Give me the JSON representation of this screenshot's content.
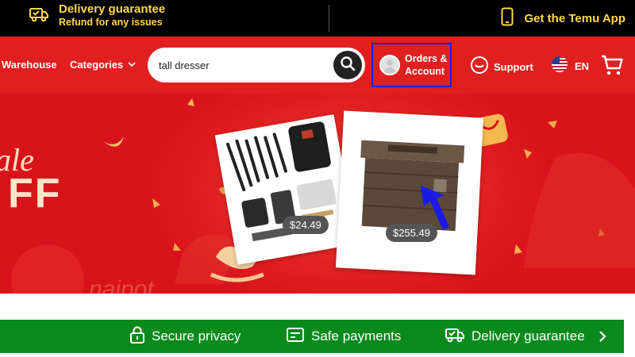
{
  "topbar": {
    "delivery_title": "Delivery guarantee",
    "delivery_sub": "Refund for any issues",
    "app_label": "Get the Temu App",
    "accent": "#ffd84a"
  },
  "header": {
    "nav": {
      "warehouse": "Warehouse",
      "categories": "Categories"
    },
    "search": {
      "value": "tall dresser",
      "icon": "search-icon"
    },
    "account": {
      "line1": "Orders &",
      "line2": "Account"
    },
    "support_label": "Support",
    "language": "EN",
    "colors": {
      "header_bg": "#e01f1f",
      "highlight_box": "#1a1ae6"
    }
  },
  "banner": {
    "sale_text": "ale",
    "off_text": "FF",
    "watermark": "naipot",
    "products": [
      {
        "name": "survival-kit",
        "price": "$24.49"
      },
      {
        "name": "fire-pit-table",
        "price": "$255.49"
      }
    ],
    "colors": {
      "banner_bg": "#d9131b"
    }
  },
  "trust_bar": {
    "items": [
      {
        "label": "Secure privacy",
        "icon": "lock-icon"
      },
      {
        "label": "Safe payments",
        "icon": "card-icon"
      },
      {
        "label": "Delivery guarantee",
        "icon": "truck-check-icon"
      }
    ],
    "colors": {
      "bg": "#0a8a1c"
    }
  }
}
